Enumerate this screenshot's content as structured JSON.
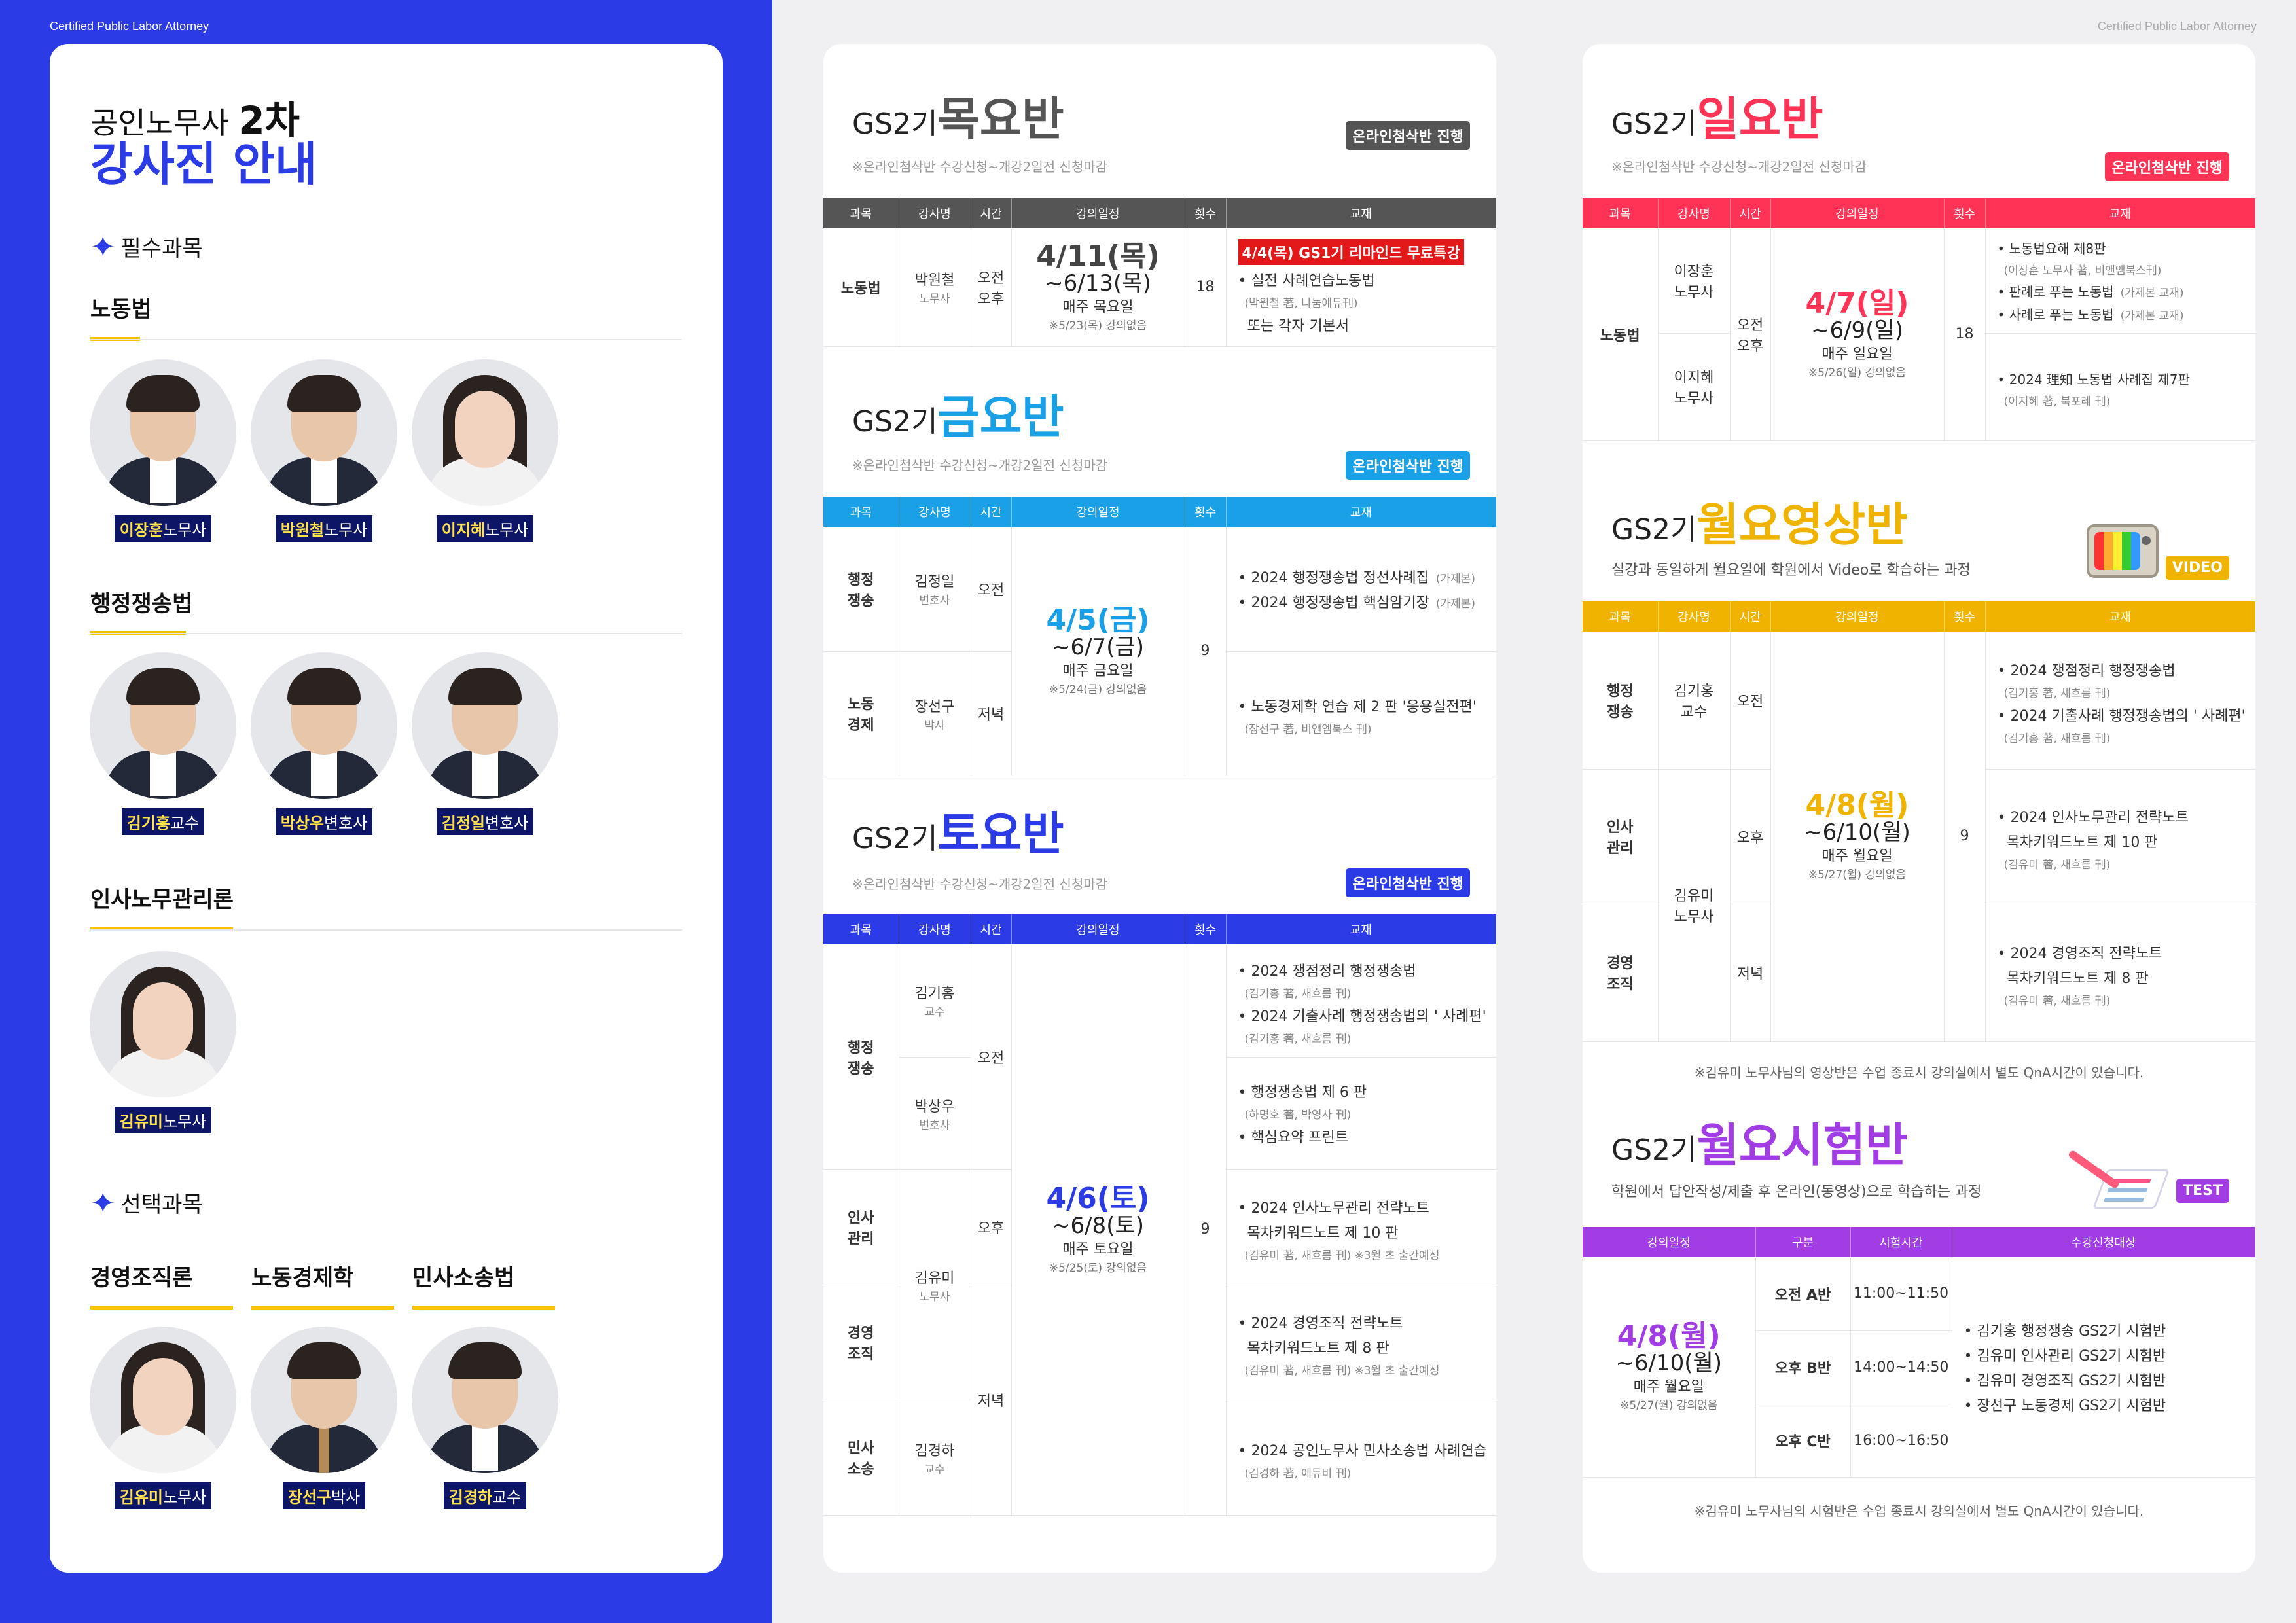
{
  "caption": "Certified Public Labor Attorney",
  "left": {
    "title_prefix": "공인노무사",
    "title_num": "2차",
    "title_main": "강사진 안내",
    "required": "필수과목",
    "optional": "선택과목",
    "subjects": {
      "labor_law": "노동법",
      "admin": "행정쟁송법",
      "hr": "인사노무관리론",
      "org": "경영조직론",
      "econ": "노동경제학",
      "civil": "민사소송법"
    },
    "lecturers": {
      "l1": {
        "name": "이장훈",
        "title": "노무사"
      },
      "l2": {
        "name": "박원철",
        "title": "노무사"
      },
      "l3": {
        "name": "이지혜",
        "title": "노무사"
      },
      "a1": {
        "name": "김기홍",
        "title": "교수"
      },
      "a2": {
        "name": "박상우",
        "title": "변호사"
      },
      "a3": {
        "name": "김정일",
        "title": "변호사"
      },
      "h1": {
        "name": "김유미",
        "title": "노무사"
      },
      "o1": {
        "name": "김유미",
        "title": "노무사"
      },
      "e1": {
        "name": "장선구",
        "title": "박사"
      },
      "c1": {
        "name": "김경하",
        "title": "교수"
      }
    }
  },
  "colors": {
    "brand": "#2b3be6",
    "thu": "#555555",
    "fri": "#1aa0e6",
    "sat": "#2b3be6",
    "sun": "#ff3355",
    "mon": "#f0b400",
    "test": "#a23de6",
    "yellow": "#f5c400"
  },
  "headers": {
    "subject": "과목",
    "lecturer": "강사명",
    "time": "시간",
    "schedule": "강의일정",
    "count": "횟수",
    "book": "교재"
  },
  "common_note": "※온라인첨삭반 수강신청~개강2일전 신청마감",
  "online_badge": "온라인첨삭반 진행",
  "gs_prefix": "GS2기",
  "thu": {
    "title": "목요반",
    "subject": "노동법",
    "lecturer": "박원철",
    "lecturer_title": "노무사",
    "time1": "오전",
    "time2": "오후",
    "start": "4/11(목)",
    "end": "~6/13(목)",
    "weekly": "매주 목요일",
    "no_class": "※5/23(목) 강의없음",
    "count": "18",
    "highlight": "4/4(목) GS1기 리마인드 무료특강",
    "book1": "• 실전 사례연습노동법",
    "book1_sub": "(박원철 著, 나눔에듀刊)",
    "book2": "또는 각자 기본서"
  },
  "fri": {
    "title": "금요반",
    "r1_subject": "행정\n쟁송",
    "r1_lecturer": "김정일",
    "r1_title": "변호사",
    "r1_time": "오전",
    "r2_subject": "노동\n경제",
    "r2_lecturer": "장선구",
    "r2_title": "박사",
    "r2_time": "저녁",
    "start": "4/5(금)",
    "end": "~6/7(금)",
    "weekly": "매주 금요일",
    "no_class": "※5/24(금) 강의없음",
    "count": "9",
    "book1": "• 2024 행정쟁송법 정선사례집",
    "book1_tag": "(가제본)",
    "book2": "• 2024 행정쟁송법 핵심암기장",
    "book2_tag": "(가제본)",
    "book3": "• 노동경제학 연습 제 2 판 '응용실전편'",
    "book3_sub": "(장선구 著, 비앤엠북스 刊)"
  },
  "sat": {
    "title": "토요반",
    "s1": "행정\n쟁송",
    "s2": "인사\n관리",
    "s3": "경영\n조직",
    "s4": "민사\n소송",
    "l1": "김기홍",
    "l1t": "교수",
    "l2": "박상우",
    "l2t": "변호사",
    "l3": "김유미",
    "l3t": "노무사",
    "l4": "김경하",
    "l4t": "교수",
    "t1": "오전",
    "t2": "오후",
    "t3": "저녁",
    "start": "4/6(토)",
    "end": "~6/8(토)",
    "weekly": "매주 토요일",
    "no_class": "※5/25(토) 강의없음",
    "count": "9",
    "b1": "• 2024 쟁점정리 행정쟁송법",
    "b1s": "(김기홍 著, 새흐름 刊)",
    "b2": "• 2024 기출사례 행정쟁송법의 ' 사례편'",
    "b2s": "(김기홍 著, 새흐름 刊)",
    "b3": "• 행정쟁송법 제 6 판",
    "b3s": "(하명호 著, 박영사 刊)",
    "b4": "• 핵심요약 프린트",
    "b5": "• 2024 인사노무관리 전략노트",
    "b5b": "목차키워드노트 제 10 판",
    "b5s": "(김유미 著, 새흐름 刊)  ※3월 초 출간예정",
    "b6": "• 2024 경영조직 전략노트",
    "b6b": "목차키워드노트 제 8 판",
    "b6s": "(김유미 著, 새흐름 刊)  ※3월 초 출간예정",
    "b7": "• 2024 공인노무사 민사소송법 사례연습",
    "b7s": "(김경하 著, 에듀비 刊)"
  },
  "sun": {
    "title": "일요반",
    "subject": "노동법",
    "l1": "이장훈",
    "l1t": "노무사",
    "l2": "이지혜",
    "l2t": "노무사",
    "time": "오전\n오후",
    "start": "4/7(일)",
    "end": "~6/9(일)",
    "weekly": "매주 일요일",
    "no_class": "※5/26(일) 강의없음",
    "count": "18",
    "b1": "• 노동법요해 제8판",
    "b1s": "(이장훈 노무사 著, 비앤엠북스刊)",
    "b2": "• 판례로 푸는 노동법",
    "b2t": "(가제본 교재)",
    "b3": "• 사례로 푸는 노동법",
    "b3t": "(가제본 교재)",
    "b4": "• 2024 理知 노동법 사례집 제7판",
    "b4s": "(이지혜 著, 북포레 刊)"
  },
  "mon": {
    "title": "월요영상반",
    "sub": "실강과 동일하게 월요일에 학원에서 Video로 학습하는 과정",
    "badge": "VIDEO",
    "s1": "행정\n쟁송",
    "s2": "인사\n관리",
    "s3": "경영\n조직",
    "l1": "김기홍",
    "l1t": "교수",
    "l2": "김유미",
    "l2t": "노무사",
    "t1": "오전",
    "t2": "오후",
    "t3": "저녁",
    "start": "4/8(월)",
    "end": "~6/10(월)",
    "weekly": "매주 월요일",
    "no_class": "※5/27(월) 강의없음",
    "count": "9",
    "b1": "• 2024 쟁점정리 행정쟁송법",
    "b1s": "(김기홍 著, 새흐름 刊)",
    "b2": "• 2024 기출사례 행정쟁송법의 ' 사례편'",
    "b2s": "(김기홍 著, 새흐름 刊)",
    "b3": "• 2024 인사노무관리 전략노트",
    "b3b": "목차키워드노트 제 10 판",
    "b3s": "(김유미 著, 새흐름 刊)",
    "b4": "• 2024 경영조직 전략노트",
    "b4b": "목차키워드노트 제 8 판",
    "b4s": "(김유미 著, 새흐름 刊)",
    "foot": "※김유미 노무사님의 영상반은 수업 종료시 강의실에서 별도 QnA시간이 있습니다."
  },
  "test": {
    "title": "월요시험반",
    "sub": "학원에서 답안작성/제출 후 온라인(동영상)으로 학습하는 과정",
    "badge": "TEST",
    "h1": "강의일정",
    "h2": "구분",
    "h3": "시험시간",
    "h4": "수강신청대상",
    "start": "4/8(월)",
    "end": "~6/10(월)",
    "weekly": "매주 월요일",
    "no_class": "※5/27(월) 강의없음",
    "r1": "오전 A반",
    "r1t": "11:00~11:50",
    "r2": "오후 B반",
    "r2t": "14:00~14:50",
    "r3": "오후 C반",
    "r3t": "16:00~16:50",
    "targets": [
      "• 김기홍 행정쟁송 GS2기 시험반",
      "• 김유미 인사관리 GS2기 시험반",
      "• 김유미 경영조직 GS2기 시험반",
      "• 장선구 노동경제 GS2기 시험반"
    ],
    "foot": "※김유미 노무사님의 시험반은 수업 종료시 강의실에서 별도 QnA시간이 있습니다."
  }
}
